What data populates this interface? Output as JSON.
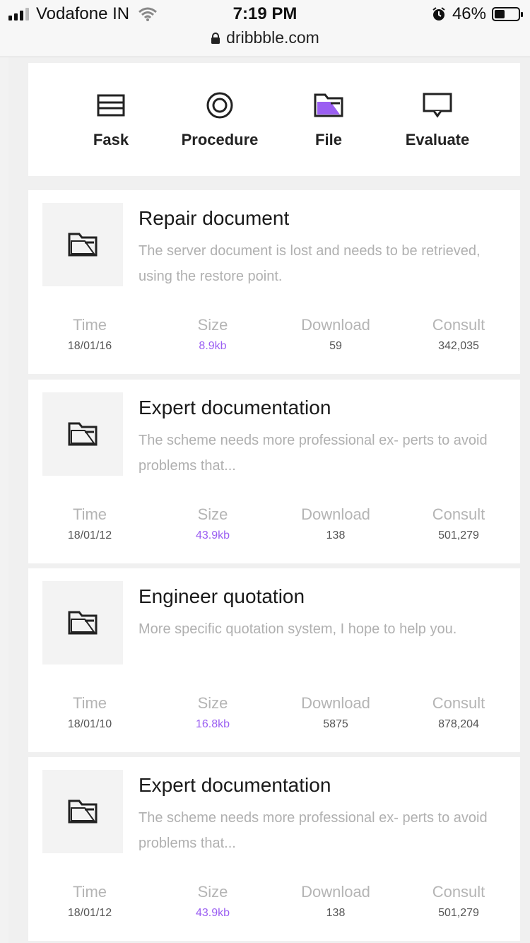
{
  "status": {
    "carrier": "Vodafone IN",
    "time": "7:19 PM",
    "battery": "46%",
    "url": "dribbble.com"
  },
  "nav": {
    "items": [
      {
        "label": "Fask",
        "icon": "card-icon"
      },
      {
        "label": "Procedure",
        "icon": "target-icon"
      },
      {
        "label": "File",
        "icon": "folder-icon"
      },
      {
        "label": "Evaluate",
        "icon": "message-icon"
      }
    ]
  },
  "stat_labels": {
    "time": "Time",
    "size": "Size",
    "download": "Download",
    "consult": "Consult"
  },
  "accent_color": "#9b5ff2",
  "cards": [
    {
      "title": "Repair document",
      "description": "The server document is lost and needs to be retrieved, using the restore point.",
      "time": "18/01/16",
      "size": "8.9kb",
      "download": "59",
      "consult": "342,035"
    },
    {
      "title": "Expert documentation",
      "description": "The scheme needs more professional ex- perts to avoid problems that...",
      "time": "18/01/12",
      "size": "43.9kb",
      "download": "138",
      "consult": "501,279"
    },
    {
      "title": "Engineer quotation",
      "description": "More specific quotation system, I hope to help you.",
      "time": "18/01/10",
      "size": "16.8kb",
      "download": "5875",
      "consult": "878,204"
    },
    {
      "title": "Expert documentation",
      "description": "The scheme needs more professional ex- perts to avoid problems that...",
      "time": "18/01/12",
      "size": "43.9kb",
      "download": "138",
      "consult": "501,279"
    }
  ]
}
